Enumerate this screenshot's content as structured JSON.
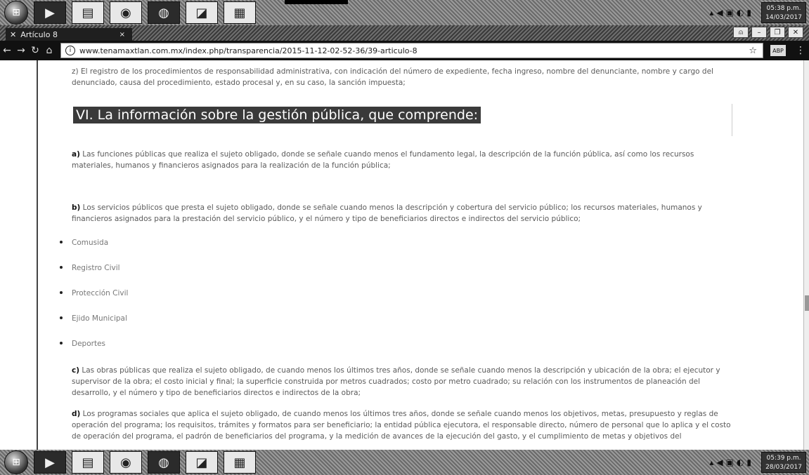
{
  "taskbar": {
    "top_clock": {
      "time": "05:38 p.m.",
      "date": "14/03/2017"
    },
    "bottom_clock": {
      "time": "05:39 p.m.",
      "date": "28/03/2017"
    },
    "apps": [
      "folder",
      "chrome",
      "firefox",
      "paint",
      "editor"
    ]
  },
  "browser": {
    "tab_title": "Artículo 8",
    "url": "www.tenamaxtlan.com.mx/index.php/transparencia/2015-11-12-02-52-36/39-articulo-8",
    "ext_label": "ABP"
  },
  "page": {
    "intro_text": "z) El registro de los procedimientos de responsabilidad administrativa, con indicación del número de expediente, fecha ingreso, nombre del denunciante, nombre y cargo del denunciado, causa del procedimiento, estado procesal y, en su caso, la sanción impuesta;",
    "heading": "VI. La información sobre la gestión pública, que comprende:",
    "item_a_label": "a)",
    "item_a": "Las funciones públicas que realiza el sujeto obligado, donde se señale cuando menos el fundamento legal, la descripción de la función pública, así como los recursos materiales, humanos y financieros asignados para la realización de la función pública;",
    "item_b_label": "b)",
    "item_b": "Los servicios públicos que presta el sujeto obligado, donde se señale cuando menos la descripción y cobertura del servicio público; los recursos materiales, humanos y financieros asignados para la prestación del servicio público, y el número y tipo de beneficiarios directos e indirectos del servicio público;",
    "services": [
      "Comusida",
      "Registro Civil",
      "Protección Civil",
      "Ejido Municipal",
      "Deportes"
    ],
    "item_c_label": "c)",
    "item_c": "Las obras públicas que realiza el sujeto obligado, de cuando menos los últimos tres años, donde se señale cuando menos la descripción y ubicación de la obra; el ejecutor y supervisor de la obra; el costo inicial y final; la superficie construida por metros cuadrados; costo por metro cuadrado; su relación con los instrumentos de planeación del desarrollo, y el número y tipo de beneficiarios directos e indirectos de la obra;",
    "item_d_label": "d)",
    "item_d": "Los programas sociales que aplica el sujeto obligado, de cuando menos los últimos tres años, donde se señale cuando menos los objetivos, metas, presupuesto y reglas de operación del programa; los requisitos, trámites y formatos para ser beneficiario; la entidad pública ejecutora, el responsable directo, número de personal que lo aplica y el costo de operación del programa, el padrón de beneficiarios del programa, y la medición de avances de la ejecución del gasto, y el cumplimiento de metas y objetivos del"
  }
}
